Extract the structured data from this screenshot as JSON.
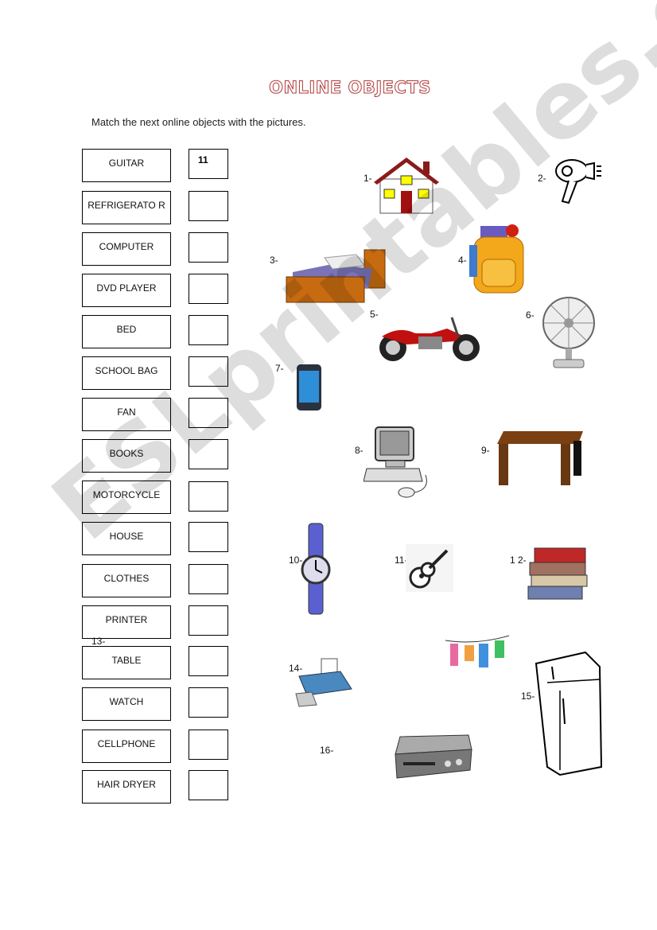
{
  "title": "ONLINE OBJECTS",
  "instruction": "Match the next online objects with the pictures.",
  "words": [
    "GUITAR",
    "REFRIGERATO R",
    "COMPUTER",
    "DVD PLAYER",
    "BED",
    "SCHOOL BAG",
    "FAN",
    "BOOKS",
    "MOTORCYCLE",
    "HOUSE",
    "CLOTHES",
    "PRINTER",
    "TABLE",
    "WATCH",
    "CELLPHONE",
    "HAIR DRYER"
  ],
  "answers": [
    "11",
    "",
    "",
    "",
    "",
    "",
    "",
    "",
    "",
    "",
    "",
    "",
    "",
    "",
    "",
    ""
  ],
  "picture_numbers": [
    "1-",
    "2-",
    "3-",
    "4-",
    "5-",
    "6-",
    "7-",
    "8-",
    "9-",
    "10-",
    "11-",
    "1 2-",
    "13-",
    "14-",
    "15-",
    "16-"
  ],
  "pictures": [
    "house-icon",
    "hair-dryer-icon",
    "bed-icon",
    "school-bag-icon",
    "motorcycle-icon",
    "fan-icon",
    "cellphone-icon",
    "computer-icon",
    "table-icon",
    "watch-icon",
    "guitar-icon",
    "books-icon",
    "clothes-icon",
    "printer-icon",
    "refrigerator-icon",
    "dvd-player-icon"
  ],
  "watermark": "ESLprintables.com",
  "colors": {
    "title_outline": "#b03a3a"
  }
}
